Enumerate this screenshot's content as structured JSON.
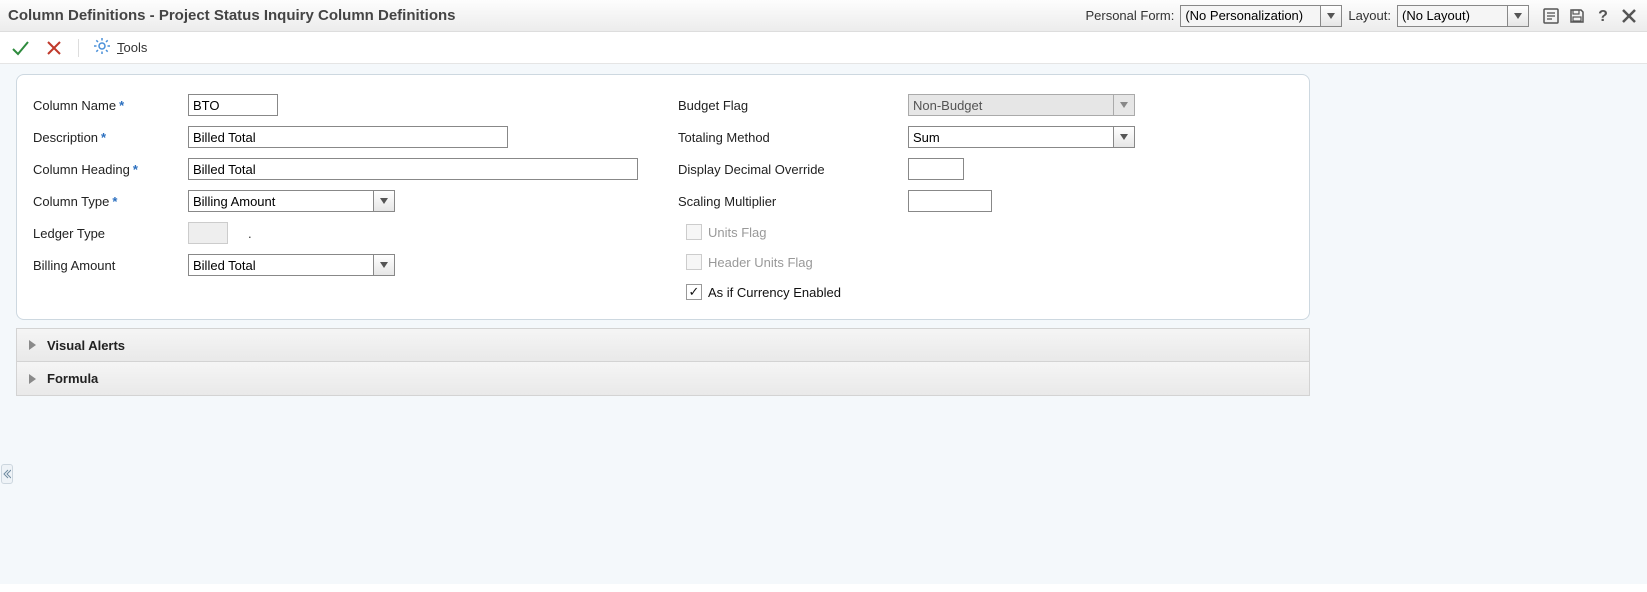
{
  "header": {
    "title": "Column Definitions - Project Status Inquiry Column Definitions",
    "personal_form_label": "Personal Form:",
    "personal_form_value": "(No Personalization)",
    "layout_label": "Layout:",
    "layout_value": "(No Layout)"
  },
  "toolbar": {
    "tools_label": "Tools"
  },
  "form": {
    "left": {
      "column_name_label": "Column Name",
      "column_name_value": "BTO",
      "description_label": "Description",
      "description_value": "Billed Total",
      "column_heading_label": "Column Heading",
      "column_heading_value": "Billed Total",
      "column_type_label": "Column Type",
      "column_type_value": "Billing Amount",
      "ledger_type_label": "Ledger Type",
      "ledger_type_value": "",
      "billing_amount_label": "Billing Amount",
      "billing_amount_value": "Billed Total"
    },
    "right": {
      "budget_flag_label": "Budget Flag",
      "budget_flag_value": "Non-Budget",
      "totaling_method_label": "Totaling Method",
      "totaling_method_value": "Sum",
      "display_decimal_label": "Display Decimal Override",
      "display_decimal_value": "",
      "scaling_mult_label": "Scaling Multiplier",
      "scaling_mult_value": "",
      "units_flag_label": "Units Flag",
      "header_units_flag_label": "Header Units Flag",
      "as_if_currency_label": "As if Currency Enabled"
    }
  },
  "accordion": {
    "visual_alerts": "Visual Alerts",
    "formula": "Formula"
  }
}
